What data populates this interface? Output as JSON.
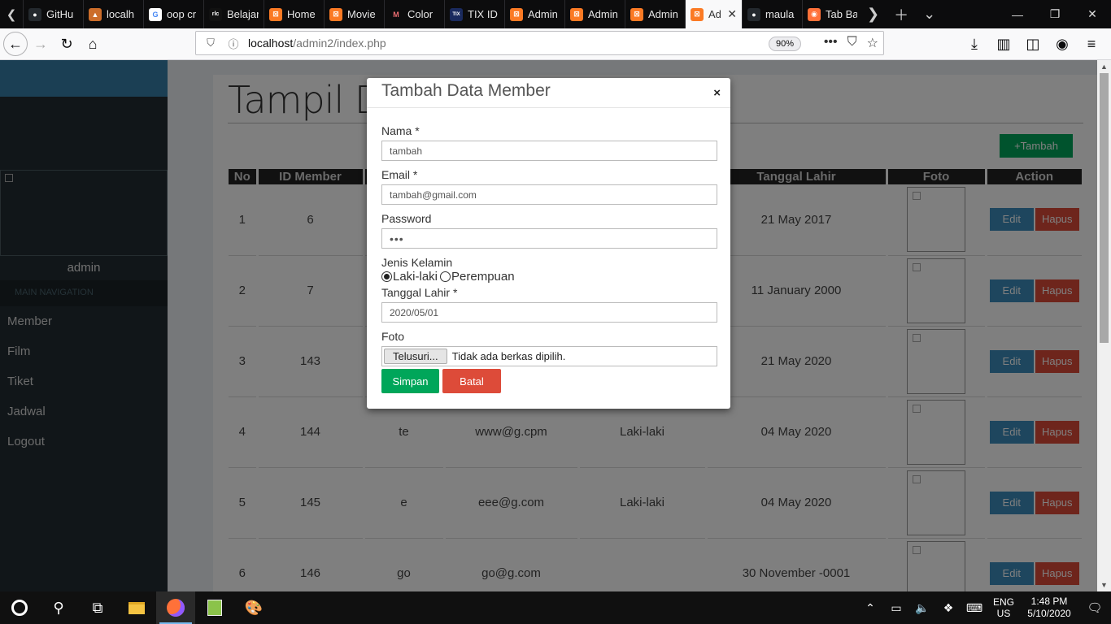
{
  "browser": {
    "tabs": [
      {
        "title": "GitHu",
        "icon": "github-icon",
        "color": "#24292e",
        "glyph": "●"
      },
      {
        "title": "localh",
        "icon": "xampp-icon",
        "color": "#cc6d2a",
        "glyph": "▲"
      },
      {
        "title": "oop cr",
        "icon": "google-icon",
        "color": "#ffffff",
        "glyph": "G"
      },
      {
        "title": "Belajar",
        "icon": "codepolitan-icon",
        "color": "#111111",
        "glyph": "rlc"
      },
      {
        "title": "Home",
        "icon": "xampp-icon",
        "color": "#fb7a24",
        "glyph": "⊠"
      },
      {
        "title": "Movie",
        "icon": "xampp-icon",
        "color": "#fb7a24",
        "glyph": "⊠"
      },
      {
        "title": "Color",
        "icon": "materialize-icon",
        "color": "#ee6e73",
        "glyph": "M"
      },
      {
        "title": "TIX ID",
        "icon": "tixid-icon",
        "color": "#1a2a5e",
        "glyph": "TIX"
      },
      {
        "title": "Admin",
        "icon": "xampp-icon",
        "color": "#fb7a24",
        "glyph": "⊠"
      },
      {
        "title": "Admin",
        "icon": "xampp-icon",
        "color": "#fb7a24",
        "glyph": "⊠"
      },
      {
        "title": "Admin",
        "icon": "xampp-icon",
        "color": "#fb7a24",
        "glyph": "⊠"
      }
    ],
    "active_tab": {
      "title": "Ad",
      "icon": "xampp-icon",
      "color": "#fb7a24",
      "glyph": "⊠",
      "close": "✕"
    },
    "tabs_after": [
      {
        "title": "maula",
        "icon": "github-icon",
        "color": "#24292e",
        "glyph": "●"
      },
      {
        "title": "Tab Ba",
        "icon": "firefox-icon",
        "color": "#ff7139",
        "glyph": "◉"
      }
    ],
    "url_host": "localhost",
    "url_path": "/admin2/index.php",
    "zoom": "90%"
  },
  "sidebar": {
    "username": "admin",
    "nav_header": "MAIN NAVIGATION",
    "items": [
      "Member",
      "Film",
      "Tiket",
      "Jadwal",
      "Logout"
    ]
  },
  "main": {
    "title": "Tampil Da",
    "add_button": "+Tambah",
    "columns": [
      "No",
      "ID Member",
      "",
      "",
      "",
      "Tanggal Lahir",
      "Foto",
      "Action"
    ],
    "rows": [
      {
        "no": "1",
        "id": "6",
        "nama": "",
        "email": "",
        "jk": "",
        "tgl": "21 May 2017"
      },
      {
        "no": "2",
        "id": "7",
        "nama": "",
        "email": "",
        "jk": "",
        "tgl": "11 January 2000"
      },
      {
        "no": "3",
        "id": "143",
        "nama": "",
        "email": "",
        "jk": "",
        "tgl": "21 May 2020"
      },
      {
        "no": "4",
        "id": "144",
        "nama": "te",
        "email": "www@g.cpm",
        "jk": "Laki-laki",
        "tgl": "04 May 2020"
      },
      {
        "no": "5",
        "id": "145",
        "nama": "e",
        "email": "eee@g.com",
        "jk": "Laki-laki",
        "tgl": "04 May 2020"
      },
      {
        "no": "6",
        "id": "146",
        "nama": "go",
        "email": "go@g.com",
        "jk": "",
        "tgl": "30 November -0001"
      }
    ],
    "edit_label": "Edit",
    "delete_label": "Hapus"
  },
  "modal": {
    "title": "Tambah Data Member",
    "close": "×",
    "nama_label": "Nama *",
    "nama_value": "tambah",
    "email_label": "Email *",
    "email_value": "tambah@gmail.com",
    "password_label": "Password",
    "password_value": "•••",
    "jk_label": "Jenis Kelamin",
    "jk_options": [
      "Laki-laki",
      "Perempuan"
    ],
    "jk_selected": "Laki-laki",
    "tgl_label": "Tanggal Lahir *",
    "tgl_value": "2020/05/01",
    "foto_label": "Foto",
    "file_button": "Telusuri...",
    "file_status": "Tidak ada berkas dipilih.",
    "save_label": "Simpan",
    "cancel_label": "Batal"
  },
  "taskbar": {
    "lang_top": "ENG",
    "lang_bottom": "US",
    "time": "1:48 PM",
    "date": "5/10/2020"
  },
  "colors": {
    "sidebar_bg": "#222d32",
    "logo_bg": "#367fa9",
    "green": "#00a65a",
    "blue": "#3c8dbc",
    "red": "#dd4b39"
  }
}
